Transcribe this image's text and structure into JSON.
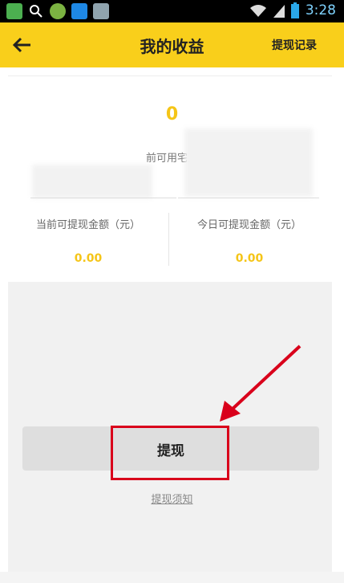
{
  "status_bar": {
    "time": "3:28",
    "left_icons": [
      "app-icon",
      "search-icon",
      "coin-icon",
      "fish-icon",
      "paw-icon"
    ],
    "right_icons": [
      "wifi-icon",
      "signal-icon",
      "battery-icon"
    ]
  },
  "header": {
    "title": "我的收益",
    "history_link": "提现记录",
    "bg_color": "#f9cf1b"
  },
  "balance": {
    "value": "0",
    "label": "前可用宅米",
    "accent_color": "#f5c518"
  },
  "stats": [
    {
      "label": "当前可提现金额（元）",
      "value": "0.00"
    },
    {
      "label": "今日可提现金额（元）",
      "value": "0.00"
    }
  ],
  "withdraw_button": {
    "label": "提现"
  },
  "notice_link": "提现须知"
}
